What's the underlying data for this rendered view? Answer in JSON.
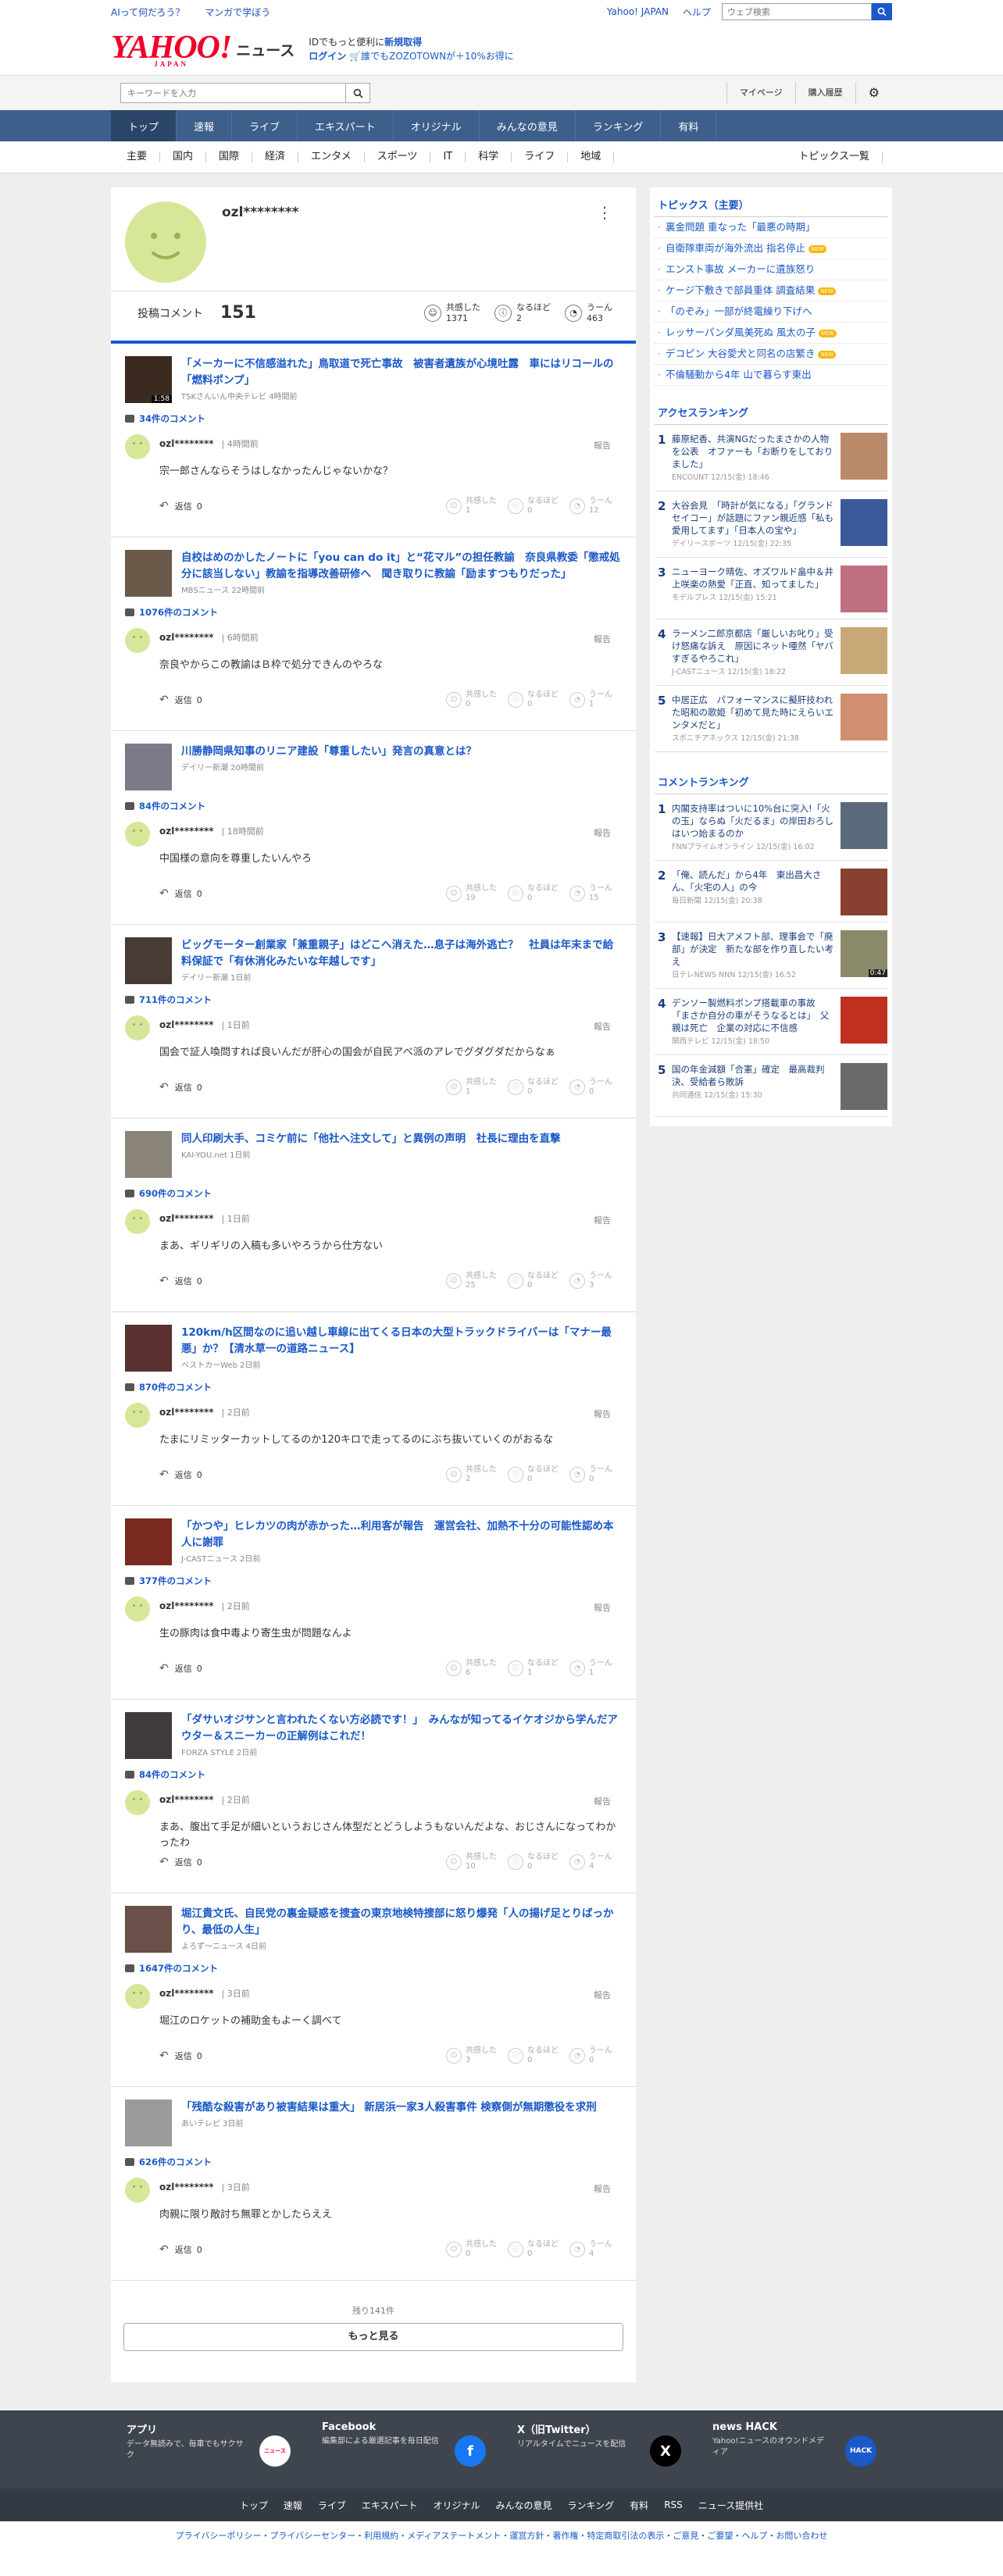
{
  "util": {
    "left1": "AIって何だろう？",
    "left2": "マンガで学ぼう",
    "yahoo": "Yahoo! JAPAN",
    "help": "ヘルプ",
    "web_search_placeholder": "ウェブ検索"
  },
  "brand": {
    "logo": "YAHOO!",
    "logo_sub": "JAPAN",
    "news": "ニュース",
    "promo_line1_a": "IDでもっと便利に",
    "promo_line1_b": "新規取得",
    "promo_login": "ログイン",
    "promo_line2": "誰でもZOZOTOWNが＋10%お得に"
  },
  "search": {
    "placeholder": "キーワードを入力",
    "mypage": "マイページ",
    "purchase": "購入履歴"
  },
  "gnav": [
    "トップ",
    "速報",
    "ライブ",
    "エキスパート",
    "オリジナル",
    "みんなの意見",
    "ランキング",
    "有料"
  ],
  "subnav": {
    "items": [
      "主要",
      "国内",
      "国際",
      "経済",
      "エンタメ",
      "スポーツ",
      "IT",
      "科学",
      "ライフ",
      "地域"
    ],
    "all": "トピックス一覧"
  },
  "profile": {
    "name": "ozl********",
    "comment_label": "投稿コメント",
    "comment_count": "151",
    "r1_label": "共感した",
    "r1_count": "1371",
    "r2_label": "なるほど",
    "r2_count": "2",
    "r3_label": "うーん",
    "r3_count": "463"
  },
  "labels": {
    "report": "報告",
    "reply": "返信",
    "kyokan": "共感した",
    "naruhodo": "なるほど",
    "uun": "うーん"
  },
  "entries": [
    {
      "title": "「メーカーに不信感溢れた」鳥取道で死亡事故　被害者遺族が心境吐露　車にはリコールの「燃料ポンプ」",
      "source": "TSKさんいん中央テレビ 4時間前",
      "duration": "1:58",
      "count": "34件のコメント",
      "user": "ozl********",
      "time": "4時間前",
      "text": "宗一郎さんならそうはしなかったんじゃないかな？",
      "replies": "0",
      "a": "1",
      "b": "0",
      "c": "12"
    },
    {
      "title": "自校はめのかしたノートに「you can do it」と“花マル”の担任教諭　奈良県教委「懲戒処分に該当しない」教諭を指導改善研修へ　聞き取りに教諭「励ますつもりだった」",
      "source": "MBSニュース 22時間前",
      "duration": "",
      "count": "1076件のコメント",
      "user": "ozl********",
      "time": "6時間前",
      "text": "奈良やからこの教諭はＢ枠で処分できんのやろな",
      "replies": "0",
      "a": "0",
      "b": "0",
      "c": "1"
    },
    {
      "title": "川勝静岡県知事のリニア建設「尊重したい」発言の真意とは？",
      "source": "デイリー新潮 20時間前",
      "duration": "",
      "count": "84件のコメント",
      "user": "ozl********",
      "time": "18時間前",
      "text": "中国様の意向を尊重したいんやろ",
      "replies": "0",
      "a": "19",
      "b": "0",
      "c": "15"
    },
    {
      "title": "ビッグモーター創業家「兼重親子」はどこへ消えた…息子は海外逃亡？　社員は年末まで給料保証で「有休消化みたいな年越しです」",
      "source": "デイリー新潮 1日前",
      "duration": "",
      "count": "711件のコメント",
      "user": "ozl********",
      "time": "1日前",
      "text": "国会で証人喚問すれば良いんだが肝心の国会が自民アベ派のアレでグダグダだからなぁ",
      "replies": "0",
      "a": "1",
      "b": "0",
      "c": "0"
    },
    {
      "title": "同人印刷大手、コミケ前に「他社へ注文して」と異例の声明　社長に理由を直撃",
      "source": "KAI-YOU.net 1日前",
      "duration": "",
      "count": "690件のコメント",
      "user": "ozl********",
      "time": "1日前",
      "text": "まあ、ギリギリの入稿も多いやろうから仕方ない",
      "replies": "0",
      "a": "25",
      "b": "0",
      "c": "3"
    },
    {
      "title": "120km/h区間なのに追い越し車線に出てくる日本の大型トラックドライバーは「マナー最悪」か？【清水草一の道路ニュース】",
      "source": "ベストカーWeb 2日前",
      "duration": "",
      "count": "870件のコメント",
      "user": "ozl********",
      "time": "2日前",
      "text": "たまにリミッターカットしてるのか120キロで走ってるのにぶち抜いていくのがおるな",
      "replies": "0",
      "a": "2",
      "b": "0",
      "c": "0"
    },
    {
      "title": "「かつや」ヒレカツの肉が赤かった…利用客が報告　運営会社、加熱不十分の可能性認め本人に謝罪",
      "source": "J-CASTニュース 2日前",
      "duration": "",
      "count": "377件のコメント",
      "user": "ozl********",
      "time": "2日前",
      "text": "生の豚肉は食中毒より寄生虫が問題なんよ",
      "replies": "0",
      "a": "6",
      "b": "1",
      "c": "1"
    },
    {
      "title": "「ダサいオジサンと言われたくない方必読です！」　みんなが知ってるイケオジから学んだアウター＆スニーカーの正解例はこれだ！",
      "source": "FORZA STYLE 2日前",
      "duration": "",
      "count": "84件のコメント",
      "user": "ozl********",
      "time": "2日前",
      "text": "まあ、腹出て手足が細いというおじさん体型だとどうしようもないんだよな、おじさんになってわかったわ",
      "replies": "0",
      "a": "10",
      "b": "0",
      "c": "4"
    },
    {
      "title": "堀江貴文氏、自民党の裏金疑惑を捜査の東京地検特捜部に怒り爆発「人の揚げ足とりばっかり、最低の人生」",
      "source": "よろず〜ニュース 4日前",
      "duration": "",
      "count": "1647件のコメント",
      "user": "ozl********",
      "time": "3日前",
      "text": "堀江のロケットの補助金もよーく調べて",
      "replies": "0",
      "a": "3",
      "b": "0",
      "c": "0"
    },
    {
      "title": "「残酷な殺害があり被害結果は重大」 新居浜一家3人殺害事件 検察側が無期懲役を求刑",
      "source": "あいテレビ 3日前",
      "duration": "",
      "count": "626件のコメント",
      "user": "ozl********",
      "time": "3日前",
      "text": "肉親に限り敵討ち無罪とかしたらええ",
      "replies": "0",
      "a": "0",
      "b": "0",
      "c": "4"
    }
  ],
  "more": {
    "remaining": "残り141件",
    "button": "もっと見る"
  },
  "topics": {
    "heading": "トピックス（主要）",
    "items": [
      {
        "text": "裏金問題 重なった「最悪の時期」",
        "new": ""
      },
      {
        "text": "自衛隊車両が海外流出 指名停止",
        "new": "NEW"
      },
      {
        "text": "エンスト事故 メーカーに遺族怒り",
        "new": ""
      },
      {
        "text": "ケージ下敷きで部員重体 調査結果",
        "new": "NEW"
      },
      {
        "text": "「のぞみ」一部が終電繰り下げへ",
        "new": ""
      },
      {
        "text": "レッサーパンダ風美死ぬ 風太の子",
        "new": "NEW"
      },
      {
        "text": "デコピン 大谷愛犬と同名の店繁き",
        "new": "NEW"
      },
      {
        "text": "不倫騒動から4年 山で暮らす東出",
        "new": ""
      }
    ]
  },
  "access": {
    "heading": "アクセスランキング",
    "items": [
      {
        "n": "1",
        "title": "藤原紀香、共演NGだったまさかの人物を公表　オファーも「お断りをしておりました」",
        "src": "ENCOUNT 12/15(金) 18:46",
        "dur": ""
      },
      {
        "n": "2",
        "title": "大谷会見　「時計が気になる」「グランドセイコー」が話題にファン親近感「私も愛用してます」「日本人の宝や」",
        "src": "デイリースポーツ 12/15(金) 22:35",
        "dur": ""
      },
      {
        "n": "3",
        "title": "ニューヨーク晴佐、オズワルド畠中＆井上咲楽の熱愛「正直、知ってました」",
        "src": "モデルプレス 12/15(金) 15:21",
        "dur": ""
      },
      {
        "n": "4",
        "title": "ラーメン二郎京都店「厳しいお叱り」受け怒痛な訴え　原因にネット唖然「ヤバすぎるやろこれ」",
        "src": "J-CASTニュース 12/15(金) 18:22",
        "dur": ""
      },
      {
        "n": "5",
        "title": "中居正広　パフォーマンスに擬肝技われた昭和の歌姫「初めて見た時にえらいエンタメだと」",
        "src": "スポニチアネックス 12/15(金) 21:38",
        "dur": ""
      }
    ]
  },
  "comment_rank": {
    "heading": "コメントランキング",
    "items": [
      {
        "n": "1",
        "title": "内閣支持率はついに10%台に突入!「火の玉」ならぬ「火だるま」の岸田おろしはいつ始まるのか",
        "src": "FNNプライムオンライン 12/15(金) 16:02",
        "dur": ""
      },
      {
        "n": "2",
        "title": "「俺、読んだ」から4年　東出昌大さん、「火宅の人」の今",
        "src": "毎日新聞 12/15(金) 20:38",
        "dur": ""
      },
      {
        "n": "3",
        "title": "【速報】日大アメフト部、理事会で「廃部」が決定　新たな部を作り直したい考え",
        "src": "日テレNEWS NNN 12/15(金) 16:52",
        "dur": "0:47"
      },
      {
        "n": "4",
        "title": "デンソー製燃料ポンプ搭載車の事故　「まさか自分の車がそうなるとは」　父親は死亡　企業の対応に不信感",
        "src": "関西テレビ 12/15(金) 18:50",
        "dur": ""
      },
      {
        "n": "5",
        "title": "国の年金減額「合憲」確定　最高裁判決、受給者ら敗訴",
        "src": "共同通信 12/15(金) 15:30",
        "dur": ""
      }
    ]
  },
  "footer": {
    "apps": [
      {
        "title": "アプリ",
        "desc": "データ無読みで、毎車でもサクサク",
        "icon": "ニュース"
      },
      {
        "title": "Facebook",
        "desc": "編集部による厳選記事を毎日配信",
        "icon": "f"
      },
      {
        "title": "X（旧Twitter）",
        "desc": "リアルタイムでニュースを配信",
        "icon": "X"
      },
      {
        "title": "news HACK",
        "desc": "Yahoo!ニュースのオウンドメディア",
        "icon": "HACK"
      }
    ],
    "nav": [
      "トップ",
      "速報",
      "ライブ",
      "エキスパート",
      "オリジナル",
      "みんなの意見",
      "ランキング",
      "有料",
      "RSS",
      "ニュース提供社"
    ],
    "links": "プライバシーポリシー・プライバシーセンター・利用規約・メディアステートメント・運営方針・著作権・特定商取引法の表示・ご意見・ご要望・ヘルプ・お問い合わせ"
  }
}
